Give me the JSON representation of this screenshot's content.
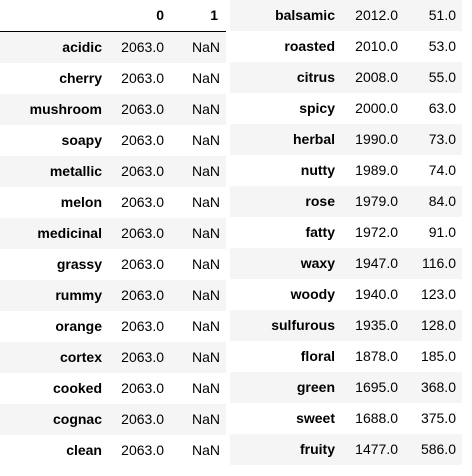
{
  "left_table": {
    "columns": [
      "",
      "0",
      "1"
    ],
    "rows": [
      {
        "index": "acidic",
        "c0": "2063.0",
        "c1": "NaN"
      },
      {
        "index": "cherry",
        "c0": "2063.0",
        "c1": "NaN"
      },
      {
        "index": "mushroom",
        "c0": "2063.0",
        "c1": "NaN"
      },
      {
        "index": "soapy",
        "c0": "2063.0",
        "c1": "NaN"
      },
      {
        "index": "metallic",
        "c0": "2063.0",
        "c1": "NaN"
      },
      {
        "index": "melon",
        "c0": "2063.0",
        "c1": "NaN"
      },
      {
        "index": "medicinal",
        "c0": "2063.0",
        "c1": "NaN"
      },
      {
        "index": "grassy",
        "c0": "2063.0",
        "c1": "NaN"
      },
      {
        "index": "rummy",
        "c0": "2063.0",
        "c1": "NaN"
      },
      {
        "index": "orange",
        "c0": "2063.0",
        "c1": "NaN"
      },
      {
        "index": "cortex",
        "c0": "2063.0",
        "c1": "NaN"
      },
      {
        "index": "cooked",
        "c0": "2063.0",
        "c1": "NaN"
      },
      {
        "index": "cognac",
        "c0": "2063.0",
        "c1": "NaN"
      },
      {
        "index": "clean",
        "c0": "2063.0",
        "c1": "NaN"
      }
    ]
  },
  "right_table": {
    "rows": [
      {
        "index": "balsamic",
        "c0": "2012.0",
        "c1": "51.0"
      },
      {
        "index": "roasted",
        "c0": "2010.0",
        "c1": "53.0"
      },
      {
        "index": "citrus",
        "c0": "2008.0",
        "c1": "55.0"
      },
      {
        "index": "spicy",
        "c0": "2000.0",
        "c1": "63.0"
      },
      {
        "index": "herbal",
        "c0": "1990.0",
        "c1": "73.0"
      },
      {
        "index": "nutty",
        "c0": "1989.0",
        "c1": "74.0"
      },
      {
        "index": "rose",
        "c0": "1979.0",
        "c1": "84.0"
      },
      {
        "index": "fatty",
        "c0": "1972.0",
        "c1": "91.0"
      },
      {
        "index": "waxy",
        "c0": "1947.0",
        "c1": "116.0"
      },
      {
        "index": "woody",
        "c0": "1940.0",
        "c1": "123.0"
      },
      {
        "index": "sulfurous",
        "c0": "1935.0",
        "c1": "128.0"
      },
      {
        "index": "floral",
        "c0": "1878.0",
        "c1": "185.0"
      },
      {
        "index": "green",
        "c0": "1695.0",
        "c1": "368.0"
      },
      {
        "index": "sweet",
        "c0": "1688.0",
        "c1": "375.0"
      },
      {
        "index": "fruity",
        "c0": "1477.0",
        "c1": "586.0"
      }
    ]
  },
  "colors": {
    "stripe": "#f5f5f5",
    "text": "#000000",
    "header_rule": "#000000"
  }
}
